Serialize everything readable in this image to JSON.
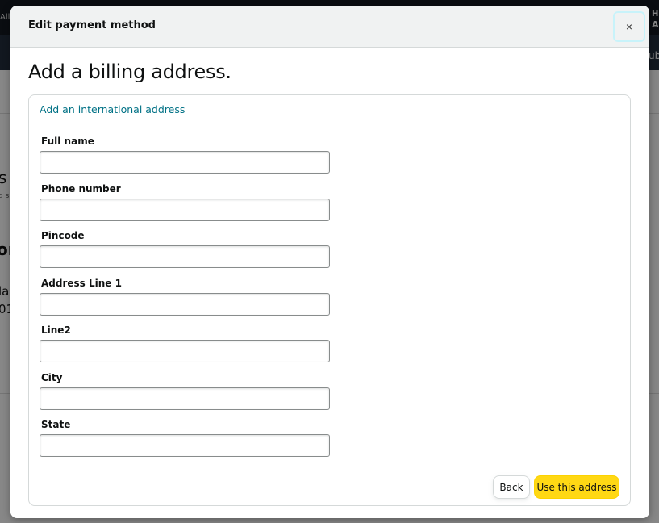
{
  "background": {
    "topbar_left_text": "All",
    "topbar_right_line1": "H",
    "topbar_right_line2": "A",
    "subbar_right_text": "ub",
    "fragment_s": "s",
    "fragment_sub": "d s",
    "fragment_or": "or",
    "fragment_la": "la",
    "fragment_01": "01"
  },
  "modal": {
    "title": "Edit payment method",
    "close_label": "×",
    "heading": "Add a billing address.",
    "international_link": "Add an international address",
    "fields": [
      {
        "label": "Full name",
        "value": ""
      },
      {
        "label": "Phone number",
        "value": ""
      },
      {
        "label": "Pincode",
        "value": ""
      },
      {
        "label": "Address Line 1",
        "value": ""
      },
      {
        "label": "Line2",
        "value": ""
      },
      {
        "label": "City",
        "value": ""
      },
      {
        "label": "State",
        "value": ""
      }
    ],
    "back_label": "Back",
    "use_address_label": "Use this address"
  }
}
